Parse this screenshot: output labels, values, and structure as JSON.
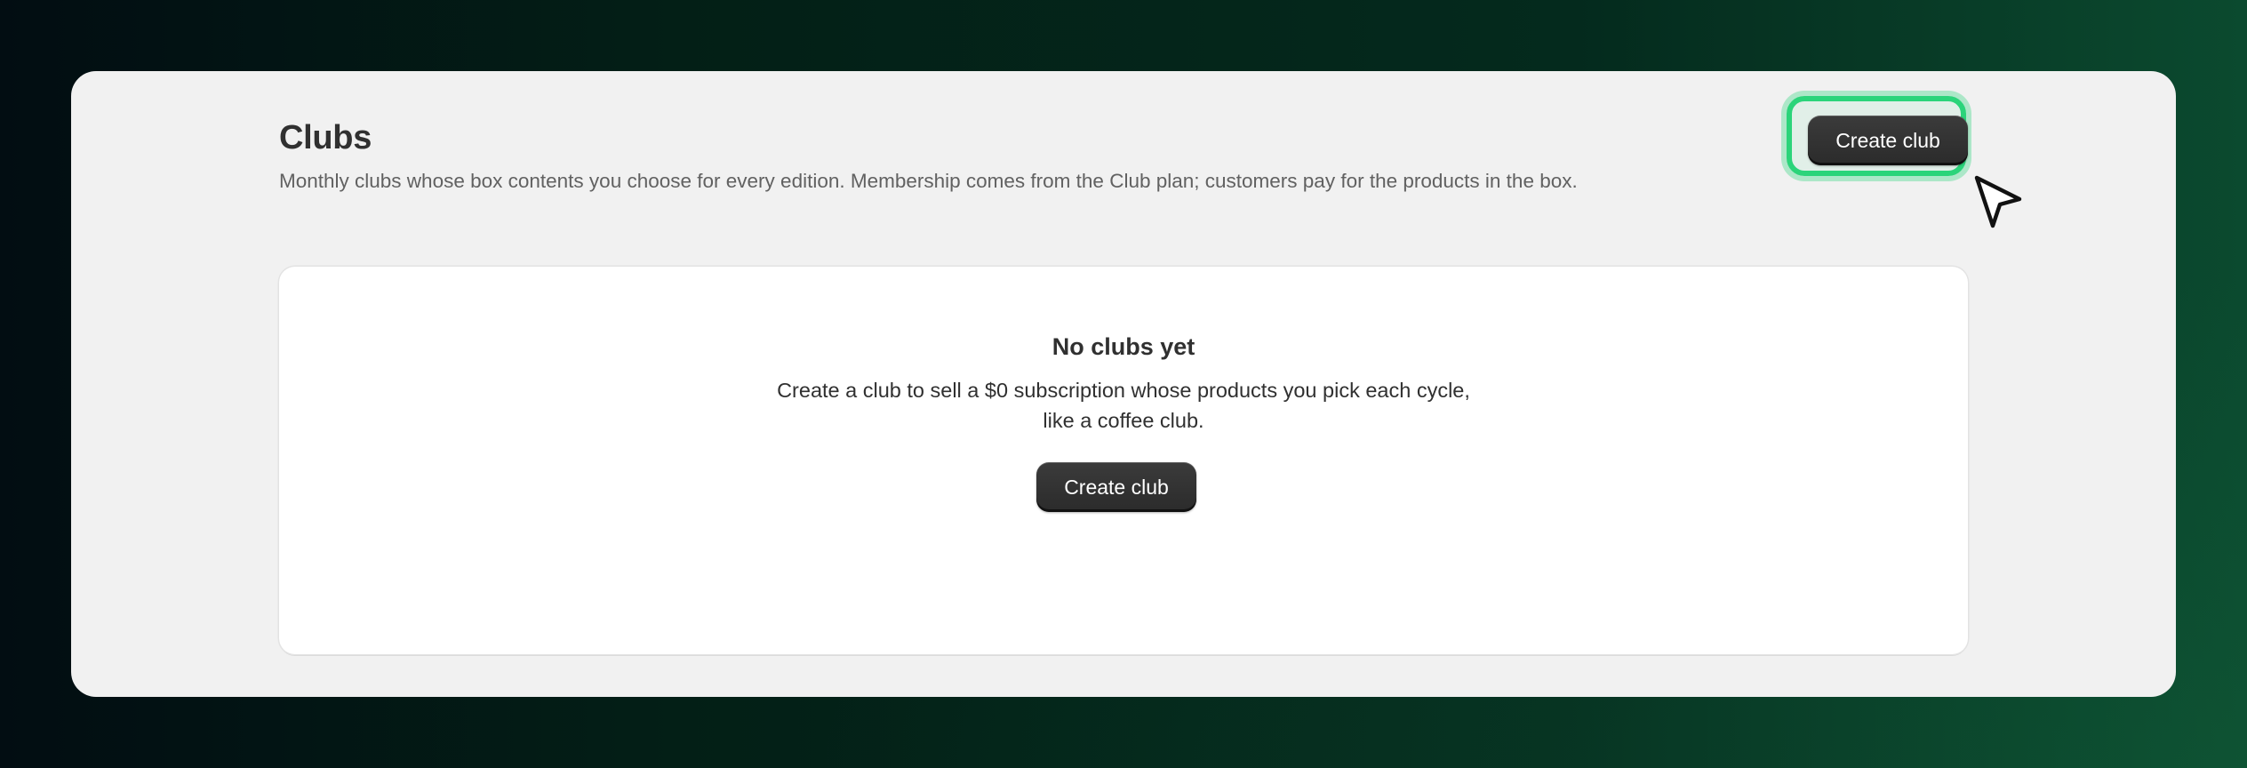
{
  "page": {
    "title": "Clubs",
    "subtitle": "Monthly clubs whose box contents you choose for every edition. Membership comes from the Club plan; customers pay for the products in the box.",
    "primary_action_label": "Create club"
  },
  "empty_state": {
    "title": "No clubs yet",
    "description": "Create a club to sell a $0 subscription whose products you pick each cycle, like a coffee club.",
    "action_label": "Create club"
  },
  "colors": {
    "focus_ring": "#2bd47a",
    "button_bg": "#303030",
    "window_bg": "#f1f1f1"
  },
  "icons": {
    "cursor": "mouse-pointer-icon"
  }
}
